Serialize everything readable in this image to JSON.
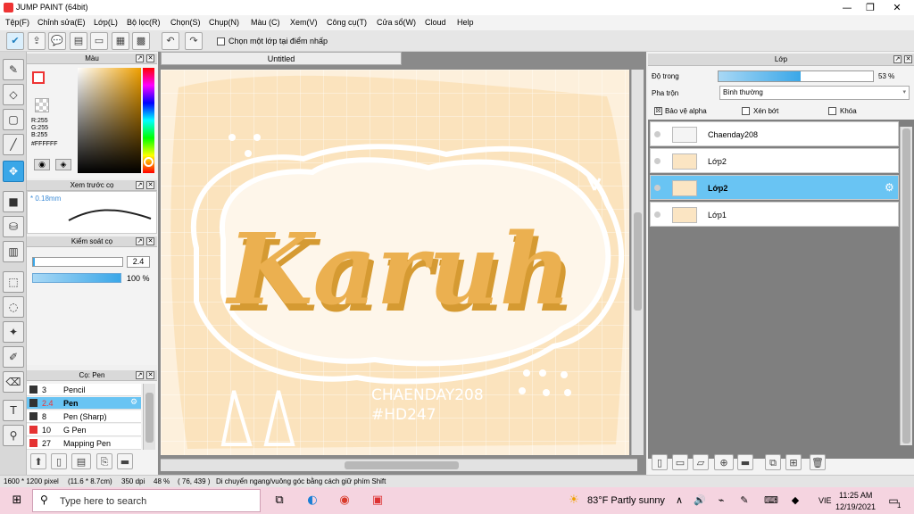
{
  "window": {
    "title": "JUMP PAINT (64bit)",
    "min": "—",
    "max": "❐",
    "close": "✕"
  },
  "menu": [
    "Tệp(F)",
    "Chỉnh sửa(E)",
    "Lớp(L)",
    "Bộ lọc(R)",
    "Chọn(S)",
    "Chụp(N)",
    "Màu (C)",
    "Xem(V)",
    "Công cụ(T)",
    "Cửa sổ(W)",
    "Cloud",
    "Help"
  ],
  "toolbar": {
    "snap_label": "Chọn một lớp tại điểm nhấp"
  },
  "color_panel": {
    "title": "Màu",
    "r": "R:255",
    "g": "G:255",
    "b": "B:255",
    "hex": "#FFFFFF"
  },
  "brush_preview": {
    "title": "Xem trước cọ",
    "size": "* 0.18mm"
  },
  "control_panel": {
    "title": "Kiểm soát cọ",
    "size_value": "2.4",
    "opacity_value": "100 %",
    "opacity": 1.0
  },
  "brush_panel": {
    "title": "Cọ: Pen",
    "items": [
      {
        "size": "3",
        "name": "Pencil",
        "color": "#333333",
        "selected": false
      },
      {
        "size": "2.4",
        "name": "Pen",
        "color": "#333333",
        "selected": true
      },
      {
        "size": "8",
        "name": "Pen (Sharp)",
        "color": "#333333",
        "selected": false
      },
      {
        "size": "10",
        "name": "G Pen",
        "color": "#e53333",
        "selected": false
      },
      {
        "size": "27",
        "name": "Mapping Pen",
        "color": "#e53333",
        "selected": false
      }
    ]
  },
  "document": {
    "tab": "Untitled"
  },
  "artwork": {
    "main_word": "Karuh",
    "credit_1": "CHAENDAY208",
    "credit_2": "#HD247"
  },
  "layer_panel": {
    "title": "Lớp",
    "opacity_label": "Độ trong",
    "opacity_value": "53 %",
    "opacity": 0.53,
    "blend_label": "Pha trộn",
    "blend_value": "Bình thường",
    "protect_alpha": "Bảo vệ alpha",
    "clip": "Xén bớt",
    "lock": "Khóa",
    "layers": [
      {
        "name": "Chaenday208",
        "selected": false
      },
      {
        "name": "Lớp2",
        "selected": false
      },
      {
        "name": "Lớp2",
        "selected": true
      },
      {
        "name": "Lớp1",
        "selected": false
      }
    ]
  },
  "status": {
    "size": "1600 * 1200 pixel",
    "physical": "(11.6 * 8.7cm)",
    "dpi": "350 dpi",
    "zoom": "48 %",
    "coords": "( 76, 439 )",
    "hint": "Di chuyển ngang/vuông góc bằng cách giữ phím Shift"
  },
  "taskbar": {
    "search_placeholder": "Type here to search",
    "weather": "83°F  Partly sunny",
    "lang": "VIE",
    "time": "11:25 AM",
    "date": "12/19/2021",
    "notif_count": "1"
  },
  "colors": {
    "accent": "#3aa7e8",
    "art_gold": "#e8a93c",
    "art_bg": "#fbe3bd",
    "taskbar": "#f5d4e0"
  }
}
